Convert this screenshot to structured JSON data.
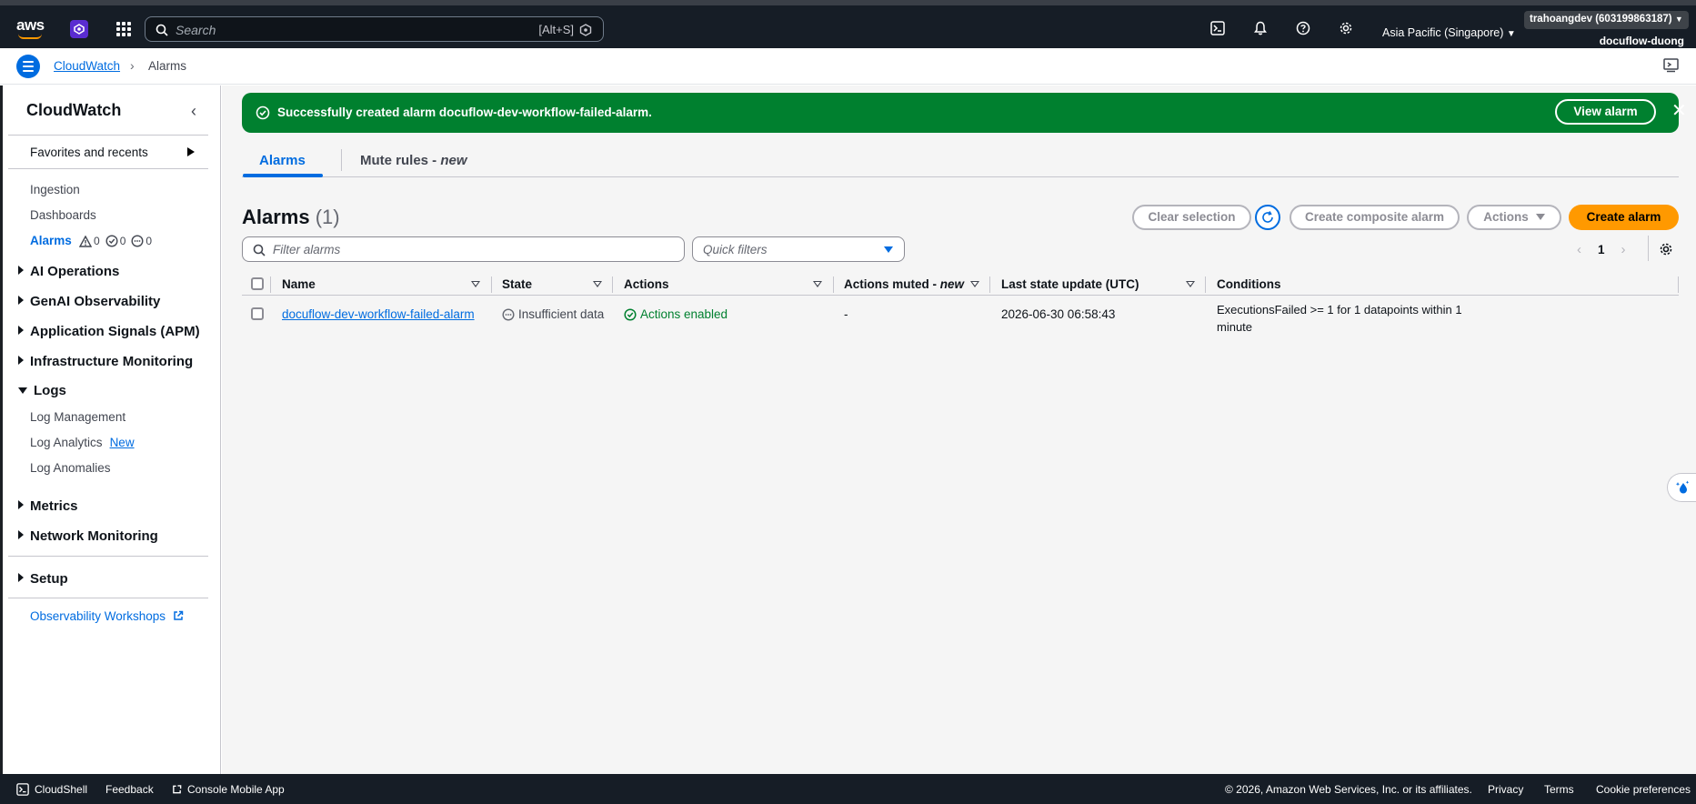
{
  "topnav": {
    "logo": "aws",
    "search_placeholder": "Search",
    "search_hint": "[Alt+S]",
    "region": "Asia Pacific (Singapore)",
    "account": "trahoangdev (603199863187)",
    "user": "docuflow-duong",
    "icons": [
      "cloudshell-icon",
      "bell-icon",
      "help-icon",
      "settings-icon"
    ]
  },
  "breadcrumb": {
    "root": "CloudWatch",
    "current": "Alarms"
  },
  "sidebar": {
    "title": "CloudWatch",
    "favorites": "Favorites and recents",
    "links": {
      "ingestion": "Ingestion",
      "dashboards": "Dashboards",
      "alarms": "Alarms"
    },
    "alarm_counts": {
      "alarm": "0",
      "ok": "0",
      "insufficient": "0"
    },
    "groups": {
      "ai_operations": "AI Operations",
      "genai": "GenAI Observability",
      "app_signals": "Application Signals (APM)",
      "infra": "Infrastructure Monitoring",
      "logs": "Logs",
      "metrics": "Metrics",
      "network": "Network Monitoring",
      "setup": "Setup"
    },
    "logs_items": {
      "log_management": "Log Management",
      "log_analytics": "Log Analytics",
      "log_analytics_badge": "New",
      "log_anomalies": "Log Anomalies"
    },
    "workshops": "Observability Workshops"
  },
  "flash": {
    "message": "Successfully created alarm docuflow-dev-workflow-failed-alarm.",
    "button": "View alarm"
  },
  "tabs": {
    "alarms": "Alarms",
    "mute_rules": "Mute rules - ",
    "mute_new": "new"
  },
  "header": {
    "title": "Alarms",
    "count": "(1)",
    "clear_selection": "Clear selection",
    "create_composite": "Create composite alarm",
    "actions": "Actions",
    "create_alarm": "Create alarm"
  },
  "filters": {
    "search_placeholder": "Filter alarms",
    "quick_filters": "Quick filters"
  },
  "pagination": {
    "page": "1"
  },
  "table": {
    "columns": {
      "name": "Name",
      "state": "State",
      "actions": "Actions",
      "muted": "Actions muted - ",
      "muted_new": "new",
      "last_update": "Last state update (UTC)",
      "conditions": "Conditions"
    },
    "rows": [
      {
        "name": "docuflow-dev-workflow-failed-alarm",
        "state": "Insufficient data",
        "actions": "Actions enabled",
        "muted": "-",
        "last_update": "2026-06-30 06:58:43",
        "conditions": "ExecutionsFailed >= 1 for 1 datapoints within 1 minute"
      }
    ]
  },
  "footer": {
    "cloudshell": "CloudShell",
    "feedback": "Feedback",
    "mobile": "Console Mobile App",
    "copyright": "© 2026, Amazon Web Services, Inc. or its affiliates.",
    "privacy": "Privacy",
    "terms": "Terms",
    "cookies": "Cookie preferences"
  },
  "colors": {
    "nav_bg": "#161d26",
    "link": "#006ce0",
    "success": "#00802f",
    "primary_button": "#ff9900"
  }
}
